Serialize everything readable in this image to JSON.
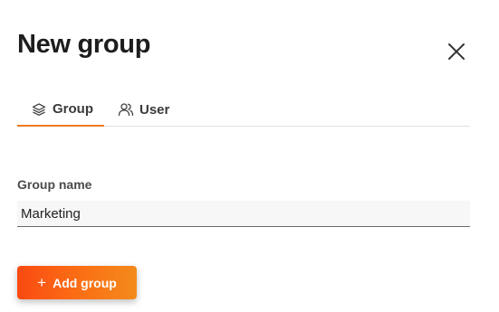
{
  "dialog": {
    "title": "New group",
    "close_icon": "close-icon"
  },
  "tabs": [
    {
      "label": "Group",
      "icon": "layers-icon",
      "active": true
    },
    {
      "label": "User",
      "icon": "users-icon",
      "active": false
    }
  ],
  "form": {
    "group_name_label": "Group name",
    "group_name_value": "Marketing"
  },
  "actions": {
    "add_icon": "plus-icon",
    "add_label": "Add group"
  },
  "colors": {
    "accent": "#ee7a1c",
    "button_gradient_start": "#fa4a12",
    "button_gradient_end": "#f48a1c"
  }
}
